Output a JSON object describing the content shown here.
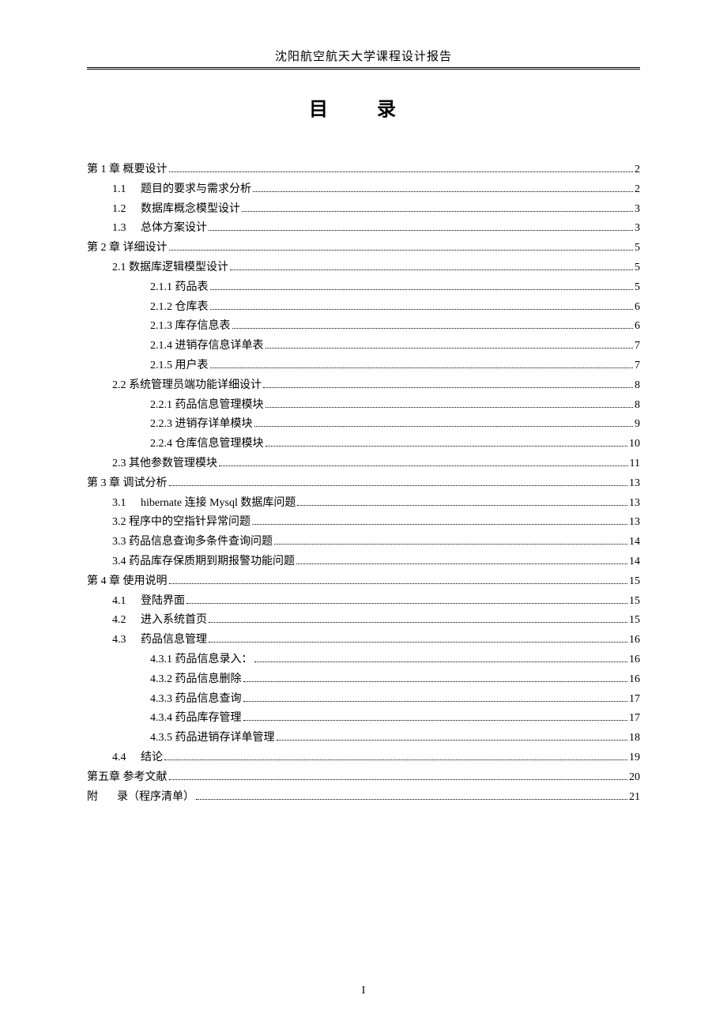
{
  "header": "沈阳航空航天大学课程设计报告",
  "toc_title": "目 录",
  "page_number": "I",
  "entries": [
    {
      "indent": 0,
      "num": "第 1 章",
      "label": "概要设计",
      "page": "2"
    },
    {
      "indent": 1,
      "num": "1.1",
      "label": "题目的要求与需求分析",
      "page": "2"
    },
    {
      "indent": 1,
      "num": "1.2",
      "label": "数据库概念模型设计",
      "page": "3"
    },
    {
      "indent": 1,
      "num": "1.3",
      "label": "总体方案设计",
      "page": "3"
    },
    {
      "indent": 0,
      "num": "第 2 章",
      "label": "详细设计",
      "page": "5"
    },
    {
      "indent": 1,
      "num": "2.1",
      "label": "数据库逻辑模型设计",
      "page": "5",
      "nogap": true
    },
    {
      "indent": 2,
      "num": "2.1.1",
      "label": "药品表",
      "page": "5",
      "nogap": true
    },
    {
      "indent": 2,
      "num": "2.1.2",
      "label": "仓库表",
      "page": "6",
      "nogap": true
    },
    {
      "indent": 2,
      "num": "2.1.3",
      "label": "库存信息表",
      "page": "6",
      "nogap": true
    },
    {
      "indent": 2,
      "num": "2.1.4",
      "label": "进销存信息详单表",
      "page": "7",
      "nogap": true
    },
    {
      "indent": 2,
      "num": "2.1.5",
      "label": "用户表",
      "page": "7",
      "nogap": true
    },
    {
      "indent": 1,
      "num": "2.2",
      "label": "系统管理员端功能详细设计",
      "page": "8",
      "nogap": true
    },
    {
      "indent": 2,
      "num": "2.2.1",
      "label": "药品信息管理模块",
      "page": "8",
      "nogap": true
    },
    {
      "indent": 2,
      "num": "2.2.3",
      "label": "进销存详单模块",
      "page": "9",
      "nogap": true
    },
    {
      "indent": 2,
      "num": "2.2.4",
      "label": "仓库信息管理模块",
      "page": "10",
      "nogap": true
    },
    {
      "indent": 1,
      "num": "2.3",
      "label": "其他参数管理模块",
      "page": "11",
      "nogap": true
    },
    {
      "indent": 0,
      "num": "第 3 章",
      "label": "调试分析",
      "page": "13"
    },
    {
      "indent": 1,
      "num": "3.1",
      "label": "hibernate 连接 Mysql 数据库问题 ",
      "page": "13"
    },
    {
      "indent": 1,
      "num": "3.2",
      "label": "程序中的空指针异常问题",
      "page": "13",
      "nogap": true
    },
    {
      "indent": 1,
      "num": "3.3",
      "label": "药品信息查询多条件查询问题",
      "page": "14",
      "nogap": true
    },
    {
      "indent": 1,
      "num": "3.4",
      "label": "药品库存保质期到期报警功能问题",
      "page": "14",
      "nogap": true
    },
    {
      "indent": 0,
      "num": "第 4 章",
      "label": "使用说明",
      "page": "15"
    },
    {
      "indent": 1,
      "num": "4.1",
      "label": "登陆界面",
      "page": "15"
    },
    {
      "indent": 1,
      "num": "4.2",
      "label": "进入系统首页",
      "page": "15"
    },
    {
      "indent": 1,
      "num": "4.3",
      "label": "药品信息管理",
      "page": "16"
    },
    {
      "indent": 2,
      "num": "4.3.1",
      "label": "药品信息录入：",
      "page": "16",
      "nogap": true
    },
    {
      "indent": 2,
      "num": "4.3.2",
      "label": "药品信息删除",
      "page": "16",
      "nogap": true
    },
    {
      "indent": 2,
      "num": "4.3.3",
      "label": "药品信息查询",
      "page": "17",
      "nogap": true
    },
    {
      "indent": 2,
      "num": "4.3.4",
      "label": "药品库存管理",
      "page": "17",
      "nogap": true
    },
    {
      "indent": 2,
      "num": "4.3.5",
      "label": "药品进销存详单管理",
      "page": "18",
      "nogap": true
    },
    {
      "indent": 1,
      "num": "4.4",
      "label": "结论",
      "page": "19"
    },
    {
      "indent": 0,
      "num": "第五章",
      "label": "参考文献",
      "page": "20",
      "nogap": true
    },
    {
      "indent": 0,
      "num": "附",
      "label": "录（程序清单）",
      "page": "21",
      "appendix": true
    }
  ]
}
